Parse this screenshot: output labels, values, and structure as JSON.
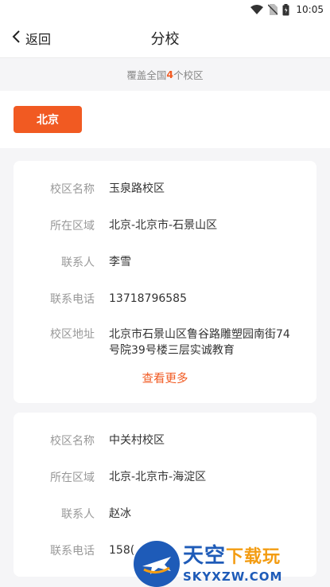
{
  "status_bar": {
    "time": "10:05"
  },
  "nav": {
    "back_label": "返回",
    "title": "分校"
  },
  "coverage": {
    "prefix": "覆盖全国",
    "count": "4",
    "suffix": "个校区"
  },
  "city_tabs": [
    {
      "label": "北京",
      "active": true
    }
  ],
  "labels": {
    "name": "校区名称",
    "region": "所在区域",
    "contact": "联系人",
    "phone": "联系电话",
    "address": "校区地址"
  },
  "campuses": [
    {
      "name": "玉泉路校区",
      "region": "北京-北京市-石景山区",
      "contact": "李雪",
      "phone": "13718796585",
      "address": "北京市石景山区鲁谷路雕塑园南街74号院39号楼三层实诚教育",
      "more_label": "查看更多"
    },
    {
      "name": "中关村校区",
      "region": "北京-北京市-海淀区",
      "contact": "赵冰",
      "phone": "158("
    }
  ],
  "watermark": {
    "main": "天空",
    "accent": "下载玩",
    "sub": "SKYXZW.COM"
  }
}
